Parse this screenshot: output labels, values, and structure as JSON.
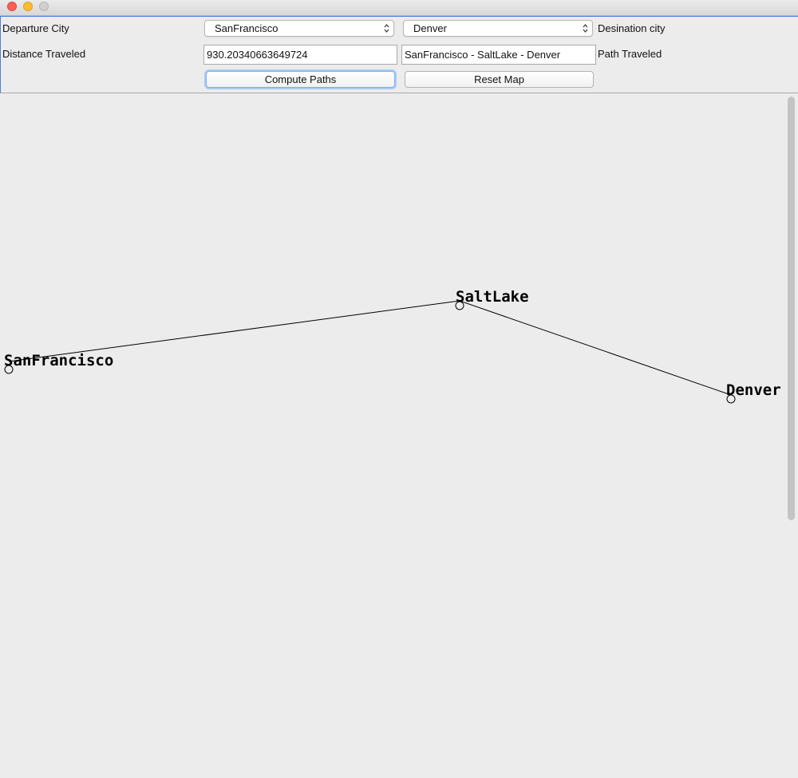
{
  "window": {
    "controls": [
      "close",
      "minimize",
      "zoom"
    ]
  },
  "form": {
    "departure_label": "Departure City",
    "departure_value": "SanFrancisco",
    "destination_value": "Denver",
    "destination_label": "Desination city",
    "distance_label": "Distance Traveled",
    "distance_value": "930.20340663649724",
    "path_value": "SanFrancisco - SaltLake - Denver",
    "path_label": "Path Traveled",
    "compute_button": "Compute Paths",
    "reset_button": "Reset Map"
  },
  "map": {
    "cities": [
      {
        "name": "SanFrancisco"
      },
      {
        "name": "SaltLake"
      },
      {
        "name": "Denver"
      }
    ],
    "route": [
      "SanFrancisco",
      "SaltLake",
      "Denver"
    ]
  },
  "colors": {
    "accent_focus": "#7aaef0",
    "window_bg": "#ececec",
    "route_line": "#000000"
  }
}
